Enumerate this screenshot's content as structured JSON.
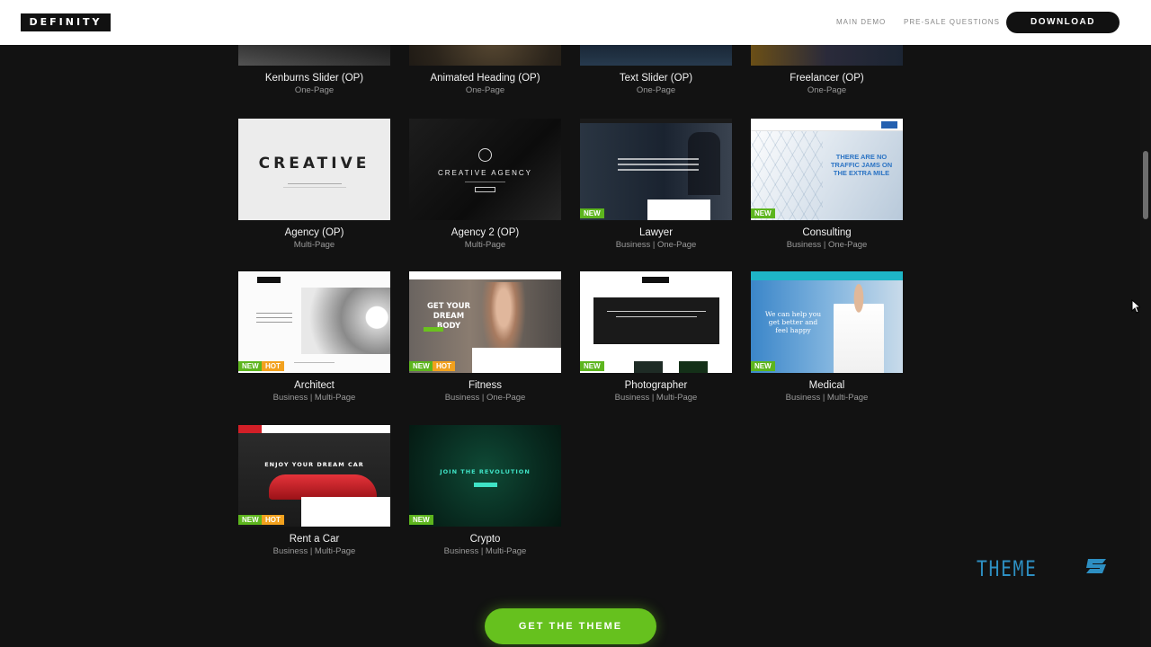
{
  "header": {
    "logo": "DEFINITY",
    "nav": [
      "MAIN DEMO",
      "PRE-SALE QUESTIONS"
    ],
    "download": "DOWNLOAD"
  },
  "demos": [
    {
      "name": "Kenburns Slider (OP)",
      "category": "One-Page"
    },
    {
      "name": "Animated Heading (OP)",
      "category": "One-Page"
    },
    {
      "name": "Text Slider (OP)",
      "category": "One-Page"
    },
    {
      "name": "Freelancer (OP)",
      "category": "One-Page"
    },
    {
      "name": "Agency (OP)",
      "category": "Multi-Page",
      "thumb_text": "CREATIVE"
    },
    {
      "name": "Agency 2 (OP)",
      "category": "Multi-Page",
      "thumb_text": "CREATIVE AGENCY"
    },
    {
      "name": "Lawyer",
      "category": "Business | One-Page",
      "badges": [
        "NEW"
      ]
    },
    {
      "name": "Consulting",
      "category": "Business | One-Page",
      "badges": [
        "NEW"
      ],
      "thumb_text": "THERE ARE NO TRAFFIC JAMS ON THE EXTRA MILE"
    },
    {
      "name": "Architect",
      "category": "Business | Multi-Page",
      "badges": [
        "NEW",
        "HOT"
      ]
    },
    {
      "name": "Fitness",
      "category": "Business | One-Page",
      "badges": [
        "NEW",
        "HOT"
      ],
      "thumb_text": "GET YOUR DREAM BODY"
    },
    {
      "name": "Photographer",
      "category": "Business | Multi-Page",
      "badges": [
        "NEW"
      ]
    },
    {
      "name": "Medical",
      "category": "Business | Multi-Page",
      "badges": [
        "NEW"
      ],
      "thumb_text": "We can help you get better and feel happy"
    },
    {
      "name": "Rent a Car",
      "category": "Business | Multi-Page",
      "badges": [
        "NEW",
        "HOT"
      ],
      "thumb_text": "ENJOY YOUR DREAM CAR"
    },
    {
      "name": "Crypto",
      "category": "Business | Multi-Page",
      "badges": [
        "NEW"
      ],
      "thumb_text": "JOIN THE REVOLUTION"
    }
  ],
  "cta": "GET THE THEME",
  "watermark": "THEME",
  "colors": {
    "badge_new": "#5db51e",
    "badge_hot": "#f2a11e",
    "cta": "#66c11e",
    "background": "#121212"
  }
}
